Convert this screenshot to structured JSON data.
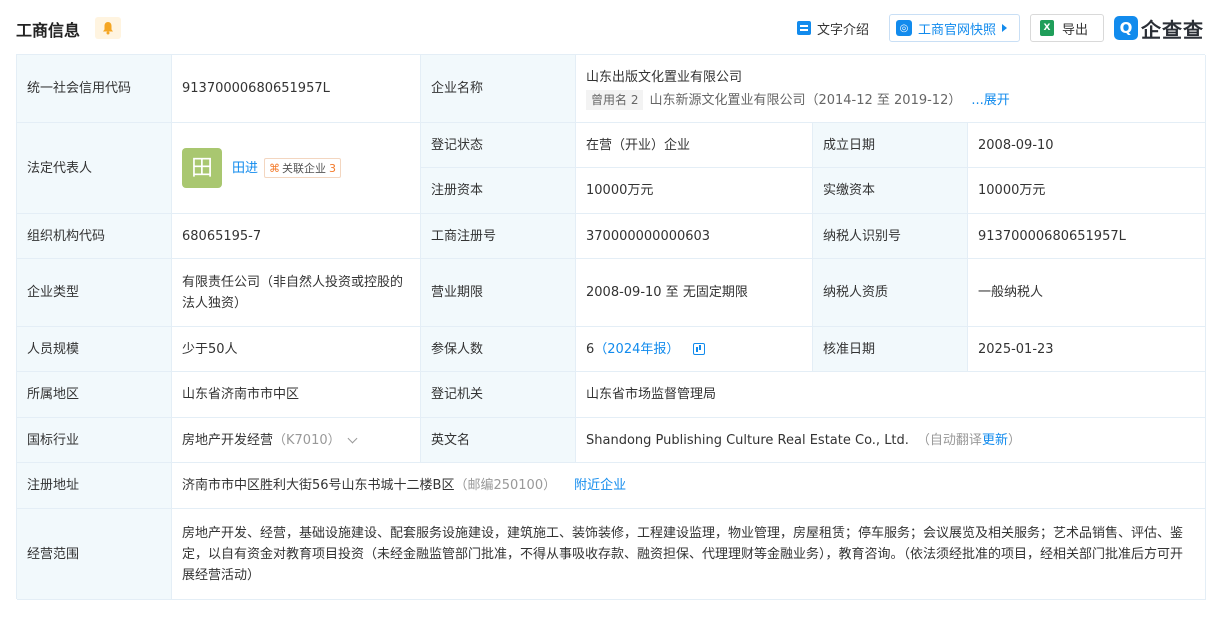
{
  "header": {
    "title": "工商信息",
    "text_intro": "文字介绍",
    "snapshot": "工商官网快照",
    "export": "导出",
    "brand": "企查查",
    "brand_logo": "Q",
    "export_icon": "X"
  },
  "info": {
    "credit_code_label": "统一社会信用代码",
    "credit_code": "91370000680651957L",
    "company_name_label": "企业名称",
    "company_name": "山东出版文化置业有限公司",
    "former_name_tag": "曾用名 2",
    "former_name": "山东新源文化置业有限公司（2014-12 至 2019-12）",
    "expand": "...展开",
    "legal_rep_label": "法定代表人",
    "legal_rep_avatar": "田",
    "legal_rep": "田进",
    "related_tag": "关联企业",
    "related_count": "3",
    "reg_status_label": "登记状态",
    "reg_status": "在营（开业）企业",
    "found_date_label": "成立日期",
    "found_date": "2008-09-10",
    "reg_capital_label": "注册资本",
    "reg_capital": "10000万元",
    "paid_capital_label": "实缴资本",
    "paid_capital": "10000万元",
    "org_code_label": "组织机构代码",
    "org_code": "68065195-7",
    "reg_no_label": "工商注册号",
    "reg_no": "370000000000603",
    "tax_id_label": "纳税人识别号",
    "tax_id": "91370000680651957L",
    "type_label": "企业类型",
    "type": "有限责任公司（非自然人投资或控股的法人独资）",
    "term_label": "营业期限",
    "term": "2008-09-10 至 无固定期限",
    "taxpayer_label": "纳税人资质",
    "taxpayer": "一般纳税人",
    "staff_label": "人员规模",
    "staff": "少于50人",
    "insured_label": "参保人数",
    "insured": "6",
    "insured_year": "（2024年报）",
    "approve_label": "核准日期",
    "approve_date": "2025-01-23",
    "region_label": "所属地区",
    "region": "山东省济南市市中区",
    "authority_label": "登记机关",
    "authority": "山东省市场监督管理局",
    "industry_label": "国标行业",
    "industry": "房地产开发经营",
    "industry_code": "（K7010）",
    "en_name_label": "英文名",
    "en_name": "Shandong Publishing Culture Real Estate Co., Ltd.",
    "auto_translate": "（自动翻译",
    "update": "更新",
    "close_paren": "）",
    "address_label": "注册地址",
    "address": "济南市市中区胜利大街56号山东书城十二楼B区",
    "postcode": "（邮编250100）",
    "nearby": "附近企业",
    "scope_label": "经营范围",
    "scope": "房地产开发、经营，基础设施建设、配套服务设施建设，建筑施工、装饰装修，工程建设监理，物业管理，房屋租赁；停车服务；会议展览及相关服务；艺术品销售、评估、鉴定，以自有资金对教育项目投资（未经金融监管部门批准，不得从事吸收存款、融资担保、代理理财等金融业务），教育咨询。（依法须经批准的项目，经相关部门批准后方可开展经营活动）"
  }
}
